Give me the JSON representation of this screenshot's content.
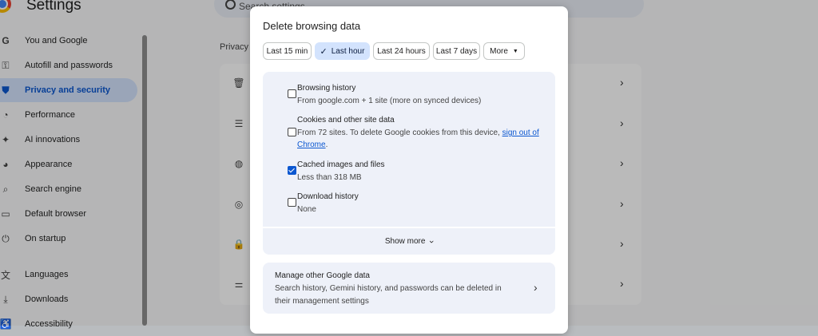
{
  "app": {
    "title": "Settings",
    "search_placeholder": "Search settings"
  },
  "sidebar": {
    "items": [
      {
        "label": "You and Google",
        "icon": "google-icon"
      },
      {
        "label": "Autofill and passwords",
        "icon": "key-icon"
      },
      {
        "label": "Privacy and security",
        "icon": "shield-icon",
        "active": true
      },
      {
        "label": "Performance",
        "icon": "gauge-icon"
      },
      {
        "label": "AI innovations",
        "icon": "sparkle-icon"
      },
      {
        "label": "Appearance",
        "icon": "palette-icon"
      },
      {
        "label": "Search engine",
        "icon": "search-icon"
      },
      {
        "label": "Default browser",
        "icon": "browser-icon"
      },
      {
        "label": "On startup",
        "icon": "power-icon"
      },
      {
        "label": "Languages",
        "icon": "translate-icon"
      },
      {
        "label": "Downloads",
        "icon": "download-icon"
      },
      {
        "label": "Accessibility",
        "icon": "accessibility-icon"
      }
    ]
  },
  "content": {
    "section_label": "Privacy"
  },
  "dialog": {
    "title": "Delete browsing data",
    "time_ranges": [
      {
        "label": "Last 15 min"
      },
      {
        "label": "Last hour",
        "selected": true
      },
      {
        "label": "Last 24 hours"
      },
      {
        "label": "Last 7 days"
      },
      {
        "label": "More"
      }
    ],
    "options": [
      {
        "title": "Browsing history",
        "desc": "From google.com + 1 site (more on synced devices)",
        "checked": false
      },
      {
        "title": "Cookies and other site data",
        "desc_prefix": "From 72 sites. To delete Google cookies from this device, ",
        "desc_link": "sign out of Chrome",
        "desc_suffix": ".",
        "checked": false
      },
      {
        "title": "Cached images and files",
        "desc": "Less than 318 MB",
        "checked": true
      },
      {
        "title": "Download history",
        "desc": "None",
        "checked": false
      }
    ],
    "show_more_label": "Show more",
    "manage": {
      "title": "Manage other Google data",
      "desc": "Search history, Gemini history, and passwords can be deleted in their management settings"
    }
  },
  "colors": {
    "accent": "#0b57d0",
    "selected_chip": "#d3e3fd",
    "panel": "#eef1f9",
    "scrim": "#000000"
  }
}
